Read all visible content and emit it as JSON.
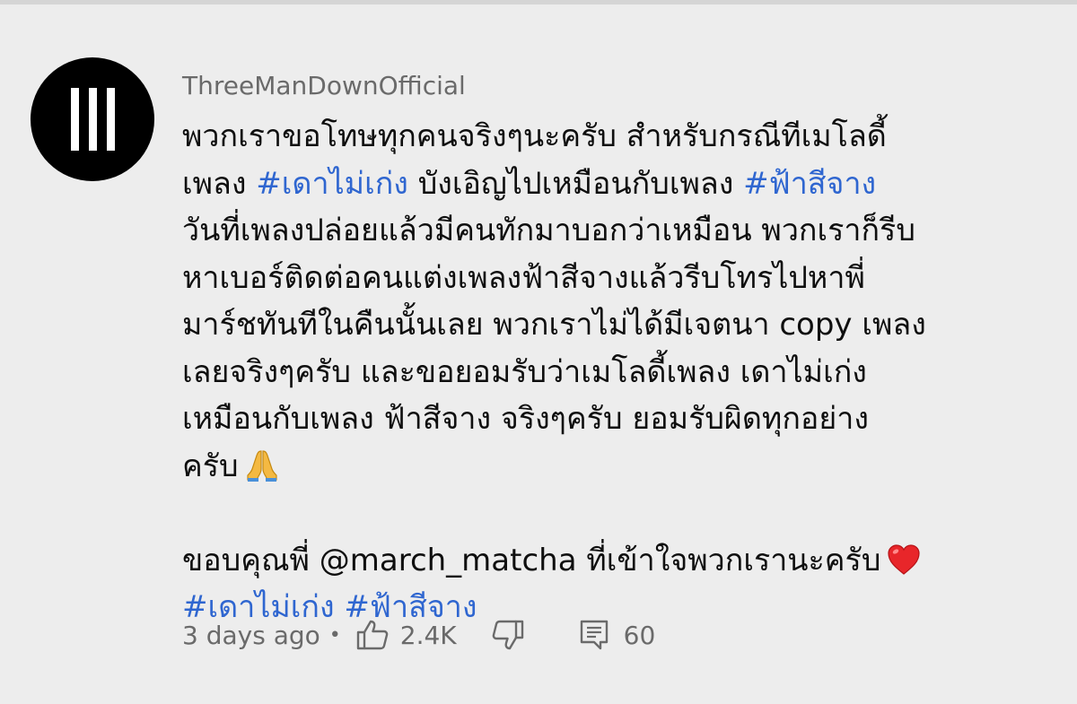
{
  "comment": {
    "author": "ThreeManDownOfficial",
    "avatar_icon": "three-bars-icon",
    "lines": [
      [
        {
          "text": "พวกเราขอโทษทุกคนจริงๆนะครับ สำหรับกรณีทีเมโลดี้",
          "tag": false
        }
      ],
      [
        {
          "text": "เพลง ",
          "tag": false
        },
        {
          "text": "#เดาไม่เก่ง",
          "tag": true
        },
        {
          "text": " บังเอิญไปเหมือนกับเพลง ",
          "tag": false
        },
        {
          "text": "#ฟ้าสีจาง",
          "tag": true
        }
      ],
      [
        {
          "text": "วันที่เพลงปล่อยแล้วมีคนทักมาบอกว่าเหมือน พวกเราก็รีบ",
          "tag": false
        }
      ],
      [
        {
          "text": "หาเบอร์ติดต่อคนแต่งเพลงฟ้าสีจางแล้วรีบโทรไปหาพี่",
          "tag": false
        }
      ],
      [
        {
          "text": "มาร์ชทันทีในคืนนั้นเลย พวกเราไม่ได้มีเจตนา copy เพลง",
          "tag": false
        }
      ],
      [
        {
          "text": "เลยจริงๆครับ และขอยอมรับว่าเมโลดี้เพลง เดาไม่เก่ง",
          "tag": false
        }
      ],
      [
        {
          "text": "เหมือนกับเพลง ฟ้าสีจาง จริงๆครับ ยอมรับผิดทุกอย่าง",
          "tag": false
        }
      ],
      [
        {
          "text": "ครับ",
          "tag": false
        },
        {
          "emoji": "folded-hands-icon"
        }
      ],
      [],
      [
        {
          "text": "ขอบคุณพี่ @march_matcha ที่เข้าใจพวกเรานะครับ",
          "tag": false
        },
        {
          "emoji": "red-heart-icon"
        }
      ],
      [
        {
          "text": "#เดาไม่เก่ง",
          "tag": true
        },
        {
          "text": " ",
          "tag": false
        },
        {
          "text": "#ฟ้าสีจาง",
          "tag": true
        }
      ]
    ],
    "time": "3 days ago",
    "separator": "•",
    "like_count": "2.4K",
    "reply_count": "60"
  },
  "colors": {
    "background": "#ededed",
    "hashtag": "#2f66d0",
    "meta_text": "#6a6a6a",
    "body_text": "#0f0f0f"
  }
}
